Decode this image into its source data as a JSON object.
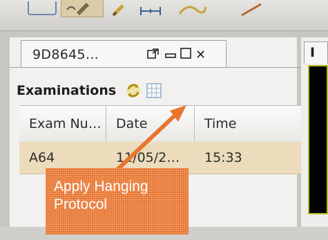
{
  "tab": {
    "title": "9D8645…",
    "controls": [
      "detach-icon",
      "minimize-icon",
      "maximize-icon",
      "close-icon"
    ],
    "close_glyph": "✕"
  },
  "examinations": {
    "title": "Examinations",
    "icons": [
      "refresh-icon",
      "grid-icon"
    ],
    "columns": [
      "Exam Nu…",
      "Date",
      "Time"
    ],
    "rows": [
      {
        "exam": "A64",
        "date": "11/05/2…",
        "time": "15:33"
      }
    ]
  },
  "callout": {
    "text": "Apply Hanging Protocol",
    "color": "#e8752f"
  },
  "right_panel": {
    "tab_label": "I"
  },
  "colors": {
    "selected_row": "#ecdcbb",
    "viewer_border": "#b8bc1f"
  }
}
